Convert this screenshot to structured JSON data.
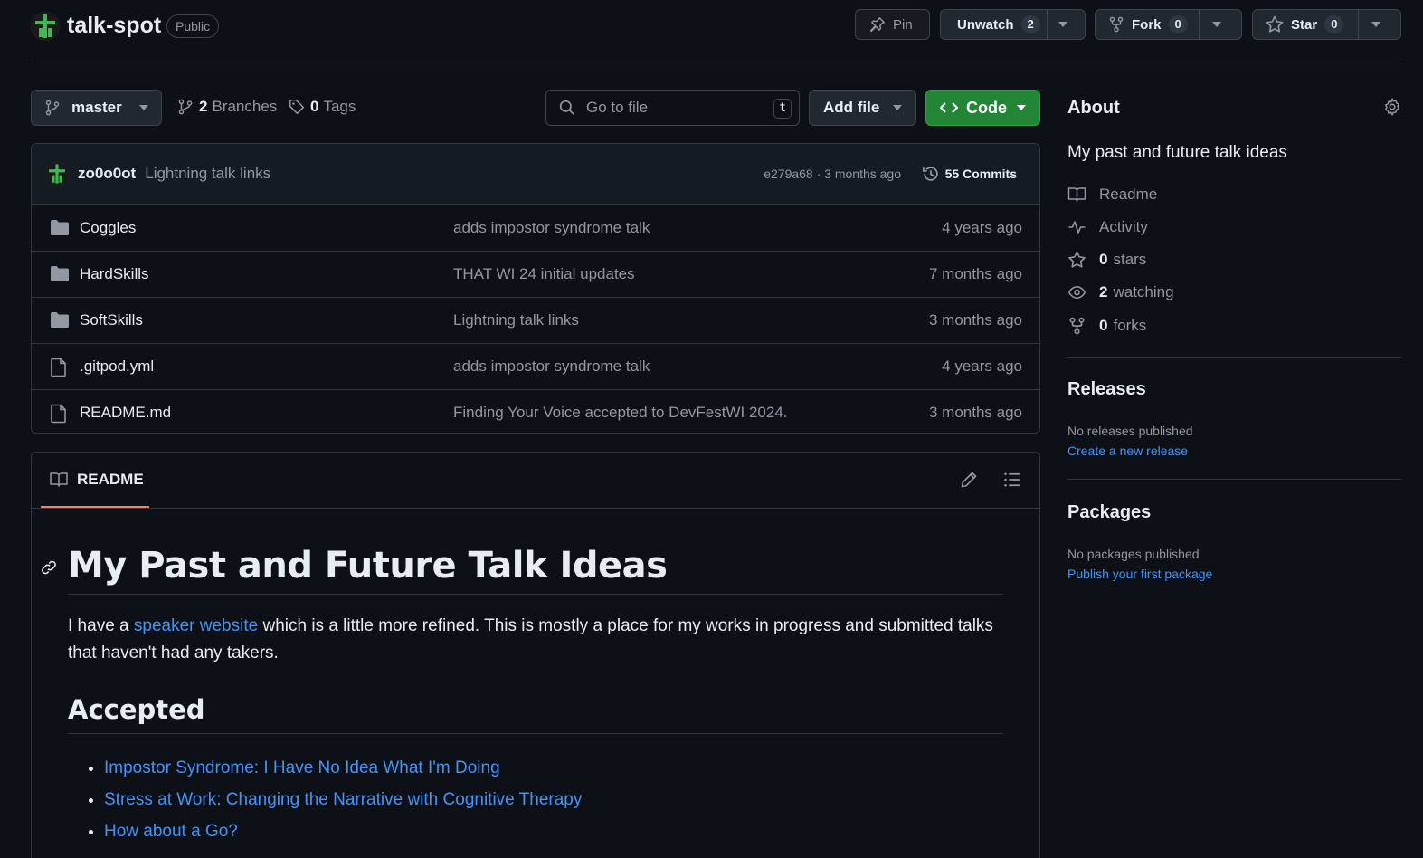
{
  "repo": {
    "name": "talk-spot",
    "visibility": "Public"
  },
  "header_actions": {
    "pin_label": "Pin",
    "unwatch_label": "Unwatch",
    "unwatch_count": "2",
    "fork_label": "Fork",
    "fork_count": "0",
    "star_label": "Star",
    "star_count": "0"
  },
  "toolbar": {
    "branch": "master",
    "branches_count": "2",
    "branches_label": "Branches",
    "tags_count": "0",
    "tags_label": "Tags",
    "goto_placeholder": "Go to file",
    "goto_key": "t",
    "add_file_label": "Add file",
    "code_label": "Code"
  },
  "latest_commit": {
    "author": "zo0o0ot",
    "message": "Lightning talk links",
    "sha_age": "e279a68 · 3 months ago",
    "commits_count": "55 Commits"
  },
  "files": [
    {
      "type": "folder",
      "name": "Coggles",
      "message": "adds impostor syndrome talk",
      "age": "4 years ago"
    },
    {
      "type": "folder",
      "name": "HardSkills",
      "message": "THAT WI 24 initial updates",
      "age": "7 months ago"
    },
    {
      "type": "folder",
      "name": "SoftSkills",
      "message": "Lightning talk links",
      "age": "3 months ago"
    },
    {
      "type": "file",
      "name": ".gitpod.yml",
      "message": "adds impostor syndrome talk",
      "age": "4 years ago"
    },
    {
      "type": "file",
      "name": "README.md",
      "message": "Finding Your Voice accepted to DevFestWI 2024.",
      "age": "3 months ago"
    }
  ],
  "readme": {
    "tab_label": "README",
    "title": "My Past and Future Talk Ideas",
    "intro_before": "I have a ",
    "intro_link": "speaker website",
    "intro_after": " which is a little more refined. This is mostly a place for my works in progress and submitted talks that haven't had any takers.",
    "section_accepted": "Accepted",
    "accepted": [
      "Impostor Syndrome: I Have No Idea What I'm Doing",
      "Stress at Work: Changing the Narrative with Cognitive Therapy",
      "How about a Go?"
    ]
  },
  "about": {
    "heading": "About",
    "description": "My past and future talk ideas",
    "readme_label": "Readme",
    "activity_label": "Activity",
    "stars_count": "0",
    "stars_label": "stars",
    "watching_count": "2",
    "watching_label": "watching",
    "forks_count": "0",
    "forks_label": "forks"
  },
  "releases": {
    "heading": "Releases",
    "empty": "No releases published",
    "link": "Create a new release"
  },
  "packages": {
    "heading": "Packages",
    "empty": "No packages published",
    "link": "Publish your first package"
  },
  "colors": {
    "background": "#0d1117",
    "border": "#30363d",
    "link": "#4493f8",
    "code_button": "#238636",
    "tab_underline": "#f78166",
    "muted_text": "#9198a1"
  }
}
